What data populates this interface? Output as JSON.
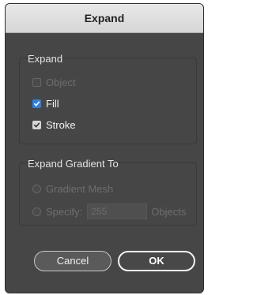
{
  "dialog": {
    "title": "Expand"
  },
  "expand_group": {
    "title": "Expand",
    "options": [
      {
        "label": "Object",
        "checked": false,
        "enabled": false
      },
      {
        "label": "Fill",
        "checked": true,
        "enabled": true
      },
      {
        "label": "Stroke",
        "checked": true,
        "enabled": true
      }
    ]
  },
  "gradient_group": {
    "title": "Expand Gradient To",
    "gradient_mesh_label": "Gradient Mesh",
    "specify_label": "Specify:",
    "specify_value": "255",
    "objects_label": "Objects"
  },
  "buttons": {
    "cancel_label": "Cancel",
    "ok_label": "OK"
  },
  "colors": {
    "dialog_bg": "#464646",
    "checkbox_accent": "#2f7fe3",
    "disabled_text": "#6e6e6e"
  }
}
